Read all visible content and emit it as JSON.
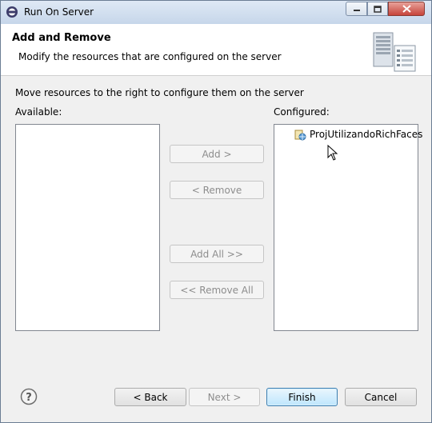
{
  "window": {
    "title": "Run On Server",
    "icons": {
      "app": "eclipse-server-icon",
      "minimize": "minimize-icon",
      "maximize": "maximize-icon",
      "close": "close-icon"
    }
  },
  "header": {
    "title": "Add and Remove",
    "description": "Modify the resources that are configured on the server",
    "image": "server-wizard-icon"
  },
  "instruction": "Move resources to the right to configure them on the server",
  "available": {
    "label": "Available:",
    "items": []
  },
  "configured": {
    "label": "Configured:",
    "items": [
      {
        "label": "ProjUtilizandoRichFaces",
        "icon": "web-project-icon"
      }
    ]
  },
  "transfer_buttons": {
    "add": "Add >",
    "remove": "< Remove",
    "add_all": "Add All >>",
    "remove_all": "<< Remove All"
  },
  "footer": {
    "help_icon": "help-icon",
    "back": "< Back",
    "next": "Next >",
    "finish": "Finish",
    "cancel": "Cancel"
  },
  "colors": {
    "titlebar": "#c6d6ea",
    "dialog_bg": "#f0f0f0",
    "default_button": "#bee6fd",
    "close_button": "#c7443a"
  }
}
